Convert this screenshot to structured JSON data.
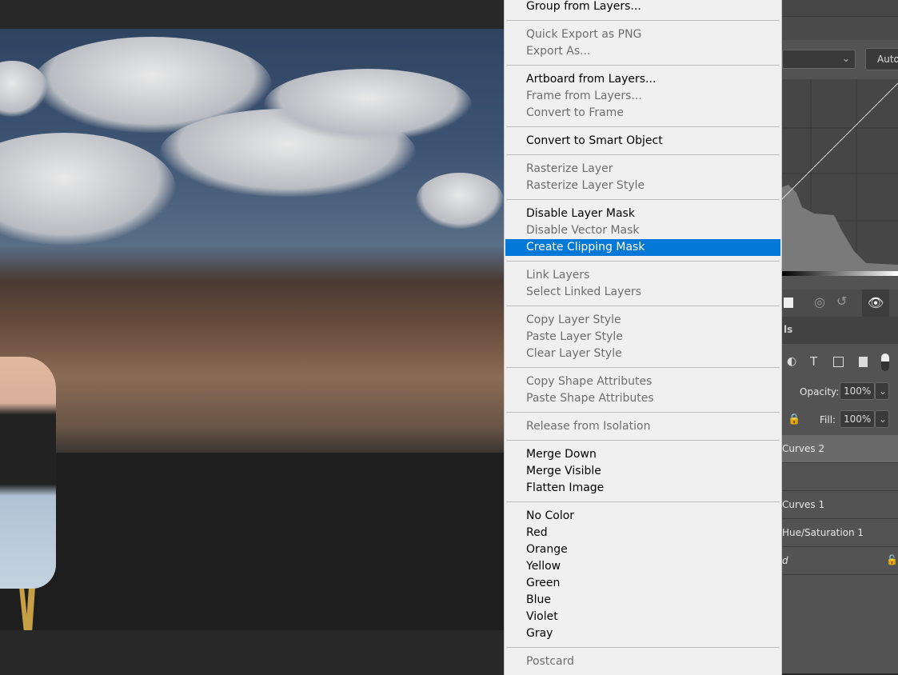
{
  "menu": {
    "sections": [
      [
        {
          "label": "Group from Layers...",
          "enabled": true
        }
      ],
      [
        {
          "label": "Quick Export as PNG",
          "enabled": false
        },
        {
          "label": "Export As...",
          "enabled": false
        }
      ],
      [
        {
          "label": "Artboard from Layers...",
          "enabled": true
        },
        {
          "label": "Frame from Layers...",
          "enabled": false
        },
        {
          "label": "Convert to Frame",
          "enabled": false
        }
      ],
      [
        {
          "label": "Convert to Smart Object",
          "enabled": true
        }
      ],
      [
        {
          "label": "Rasterize Layer",
          "enabled": false
        },
        {
          "label": "Rasterize Layer Style",
          "enabled": false
        }
      ],
      [
        {
          "label": "Disable Layer Mask",
          "enabled": true
        },
        {
          "label": "Disable Vector Mask",
          "enabled": false
        },
        {
          "label": "Create Clipping Mask",
          "enabled": true,
          "highlighted": true
        }
      ],
      [
        {
          "label": "Link Layers",
          "enabled": false
        },
        {
          "label": "Select Linked Layers",
          "enabled": false
        }
      ],
      [
        {
          "label": "Copy Layer Style",
          "enabled": false
        },
        {
          "label": "Paste Layer Style",
          "enabled": false
        },
        {
          "label": "Clear Layer Style",
          "enabled": false
        }
      ],
      [
        {
          "label": "Copy Shape Attributes",
          "enabled": false
        },
        {
          "label": "Paste Shape Attributes",
          "enabled": false
        }
      ],
      [
        {
          "label": "Release from Isolation",
          "enabled": false
        }
      ],
      [
        {
          "label": "Merge Down",
          "enabled": true
        },
        {
          "label": "Merge Visible",
          "enabled": true
        },
        {
          "label": "Flatten Image",
          "enabled": true
        }
      ],
      [
        {
          "label": "No Color",
          "enabled": true
        },
        {
          "label": "Red",
          "enabled": true
        },
        {
          "label": "Orange",
          "enabled": true
        },
        {
          "label": "Yellow",
          "enabled": true
        },
        {
          "label": "Green",
          "enabled": true
        },
        {
          "label": "Blue",
          "enabled": true
        },
        {
          "label": "Violet",
          "enabled": true
        },
        {
          "label": "Gray",
          "enabled": true
        }
      ],
      [
        {
          "label": "Postcard",
          "enabled": false
        }
      ]
    ]
  },
  "properties": {
    "auto_label": "Auto"
  },
  "layers": {
    "tab_partial": "ls",
    "opacity_label": "Opacity:",
    "opacity": "100%",
    "fill_label": "Fill:",
    "fill": "100%",
    "items": [
      {
        "name": "Curves 2",
        "selected": true
      },
      {
        "name": ""
      },
      {
        "name": "Curves 1"
      },
      {
        "name": "Hue/Saturation 1"
      },
      {
        "name": "d"
      }
    ]
  },
  "colors": {
    "highlight": "#0078d7",
    "menu_bg": "#f0f0f0",
    "panel_bg": "#535353"
  }
}
